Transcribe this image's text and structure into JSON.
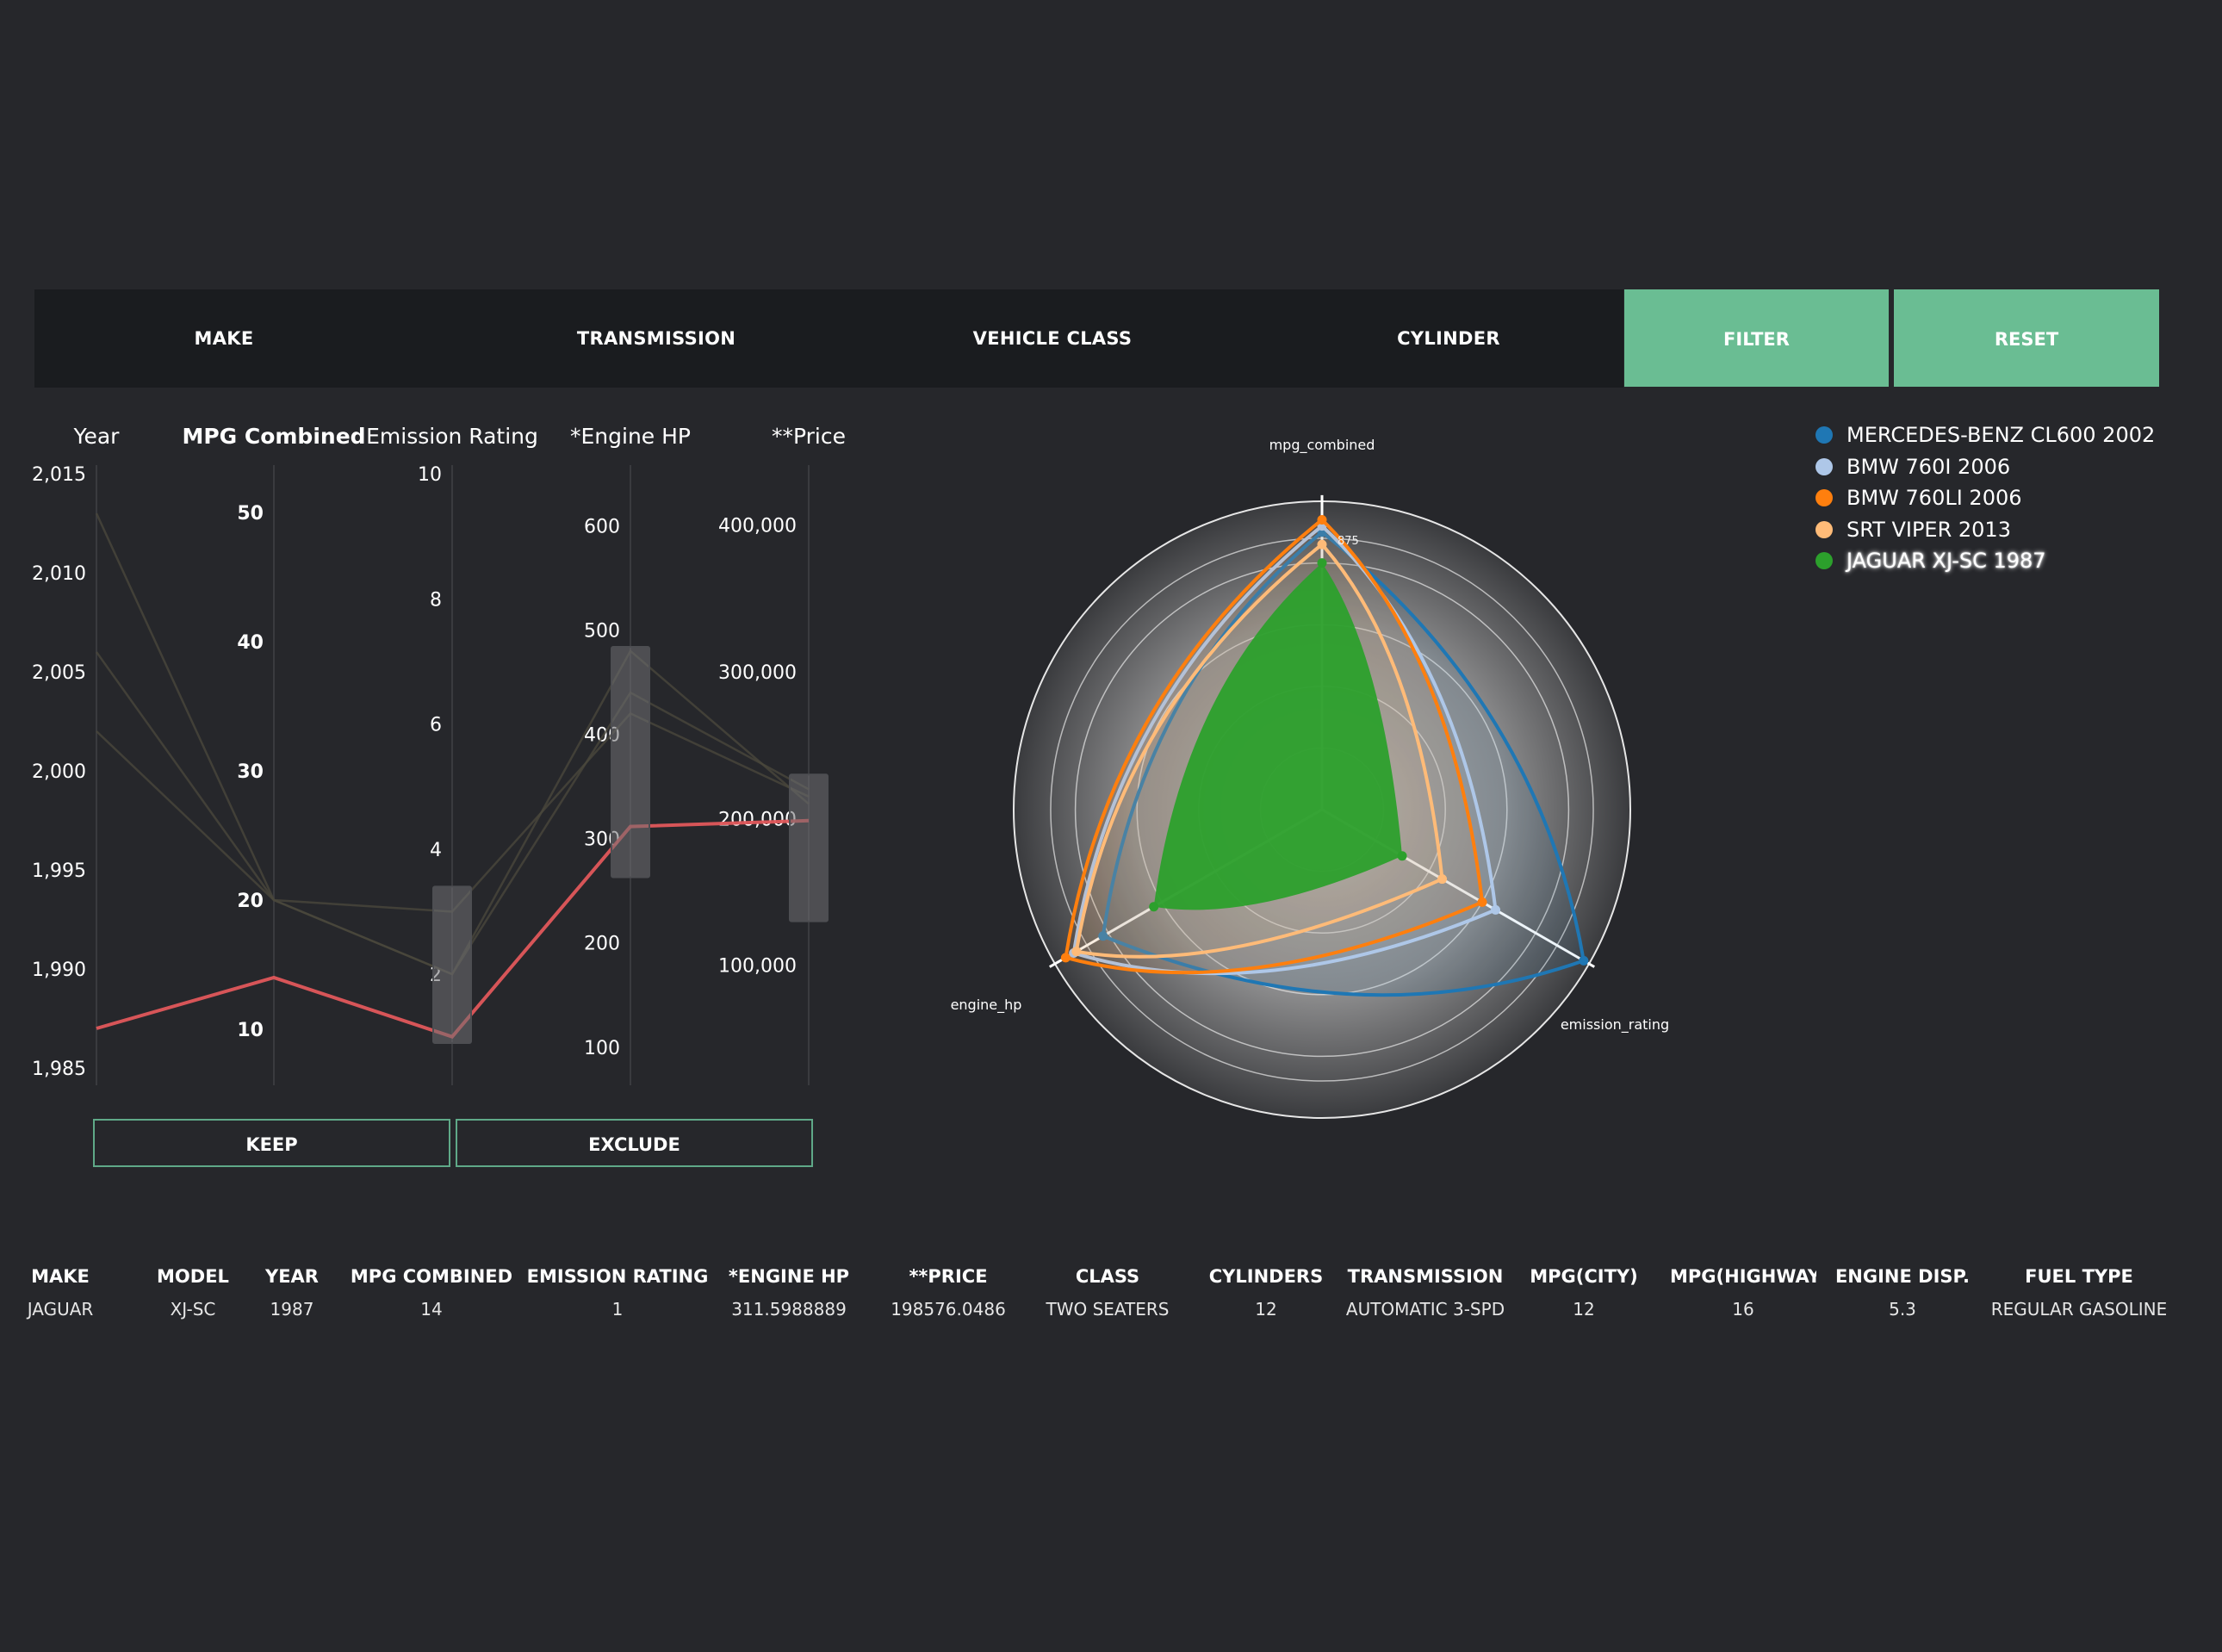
{
  "toolbar": {
    "make": "MAKE",
    "transmission": "TRANSMISSION",
    "vehicle_class": "VEHICLE CLASS",
    "cylinder": "CYLINDER",
    "filter": "FILTER",
    "reset": "RESET"
  },
  "buttons": {
    "keep": "KEEP",
    "exclude": "EXCLUDE"
  },
  "colors": {
    "background": "#26272b",
    "toolbar": "#1a1c1f",
    "accent": "#6abd93",
    "highlight_line": "#e0575b",
    "radar_fill": "#2ca02c"
  },
  "chart_data": [
    {
      "type": "parallel-coordinates",
      "axes": [
        {
          "label": "Year",
          "ticks": [
            "2,015",
            "2,010",
            "2,005",
            "2,000",
            "1,995",
            "1,990",
            "1,985"
          ],
          "range": [
            1985,
            2015
          ]
        },
        {
          "label": "MPG Combined",
          "ticks": [
            "50",
            "40",
            "30",
            "20",
            "10"
          ],
          "range": [
            7,
            53
          ]
        },
        {
          "label": "Emission Rating",
          "ticks": [
            "10",
            "8",
            "6",
            "4",
            "2"
          ],
          "range": [
            0.5,
            10
          ]
        },
        {
          "label": "*Engine HP",
          "ticks": [
            "600",
            "500",
            "400",
            "300",
            "200",
            "100"
          ],
          "range": [
            80,
            650
          ]
        },
        {
          "label": "**Price",
          "ticks": [
            "400,000",
            "300,000",
            "200,000",
            "100,000"
          ],
          "range": [
            30000,
            435000
          ]
        }
      ],
      "brushes": [
        {
          "axis": "Emission Rating",
          "range": [
            0.9,
            3.4
          ]
        },
        {
          "axis": "*Engine HP",
          "range": [
            263,
            484
          ]
        },
        {
          "axis": "**Price",
          "range": [
            130000,
            230000
          ]
        }
      ],
      "series": [
        {
          "values": [
            2013,
            20,
            2,
            440,
            220000
          ],
          "highlight": false
        },
        {
          "values": [
            2006,
            20,
            2,
            480,
            210000
          ],
          "highlight": false
        },
        {
          "values": [
            2002,
            20,
            3,
            420,
            215000
          ],
          "highlight": false
        },
        {
          "values": [
            1987,
            14,
            1,
            311.5988889,
            198576.0486
          ],
          "highlight": true
        }
      ]
    },
    {
      "type": "radar",
      "axes": [
        "mpg_combined",
        "emission_rating",
        "engine_hp"
      ],
      "center_label": "875",
      "series": [
        {
          "name": "MERCEDES-BENZ CL600 2002",
          "color": "#1f77b4",
          "values": [
            0.9,
            0.98,
            0.82
          ]
        },
        {
          "name": "BMW 760I 2006",
          "color": "#aec7e8",
          "values": [
            0.92,
            0.65,
            0.93
          ]
        },
        {
          "name": "BMW 760LI 2006",
          "color": "#ff7f0e",
          "values": [
            0.94,
            0.6,
            0.96
          ]
        },
        {
          "name": "SRT VIPER 2013",
          "color": "#ffbb78",
          "values": [
            0.86,
            0.45,
            0.92
          ]
        },
        {
          "name": "JAGUAR XJ-SC 1987",
          "color": "#2ca02c",
          "values": [
            0.8,
            0.3,
            0.63
          ],
          "filled": true
        }
      ]
    }
  ],
  "table": {
    "headers": [
      "MAKE",
      "MODEL",
      "YEAR",
      "MPG COMBINED",
      "EMISSION RATING",
      "*ENGINE HP",
      "**PRICE",
      "CLASS",
      "CYLINDERS",
      "TRANSMISSION",
      "MPG(CITY)",
      "MPG(HIGHWAY)",
      "ENGINE DISP.",
      "FUEL TYPE"
    ],
    "row": [
      "JAGUAR",
      "XJ-SC",
      "1987",
      "14",
      "1",
      "311.5988889",
      "198576.0486",
      "TWO SEATERS",
      "12",
      "AUTOMATIC 3-SPD",
      "12",
      "16",
      "5.3",
      "REGULAR GASOLINE"
    ]
  }
}
